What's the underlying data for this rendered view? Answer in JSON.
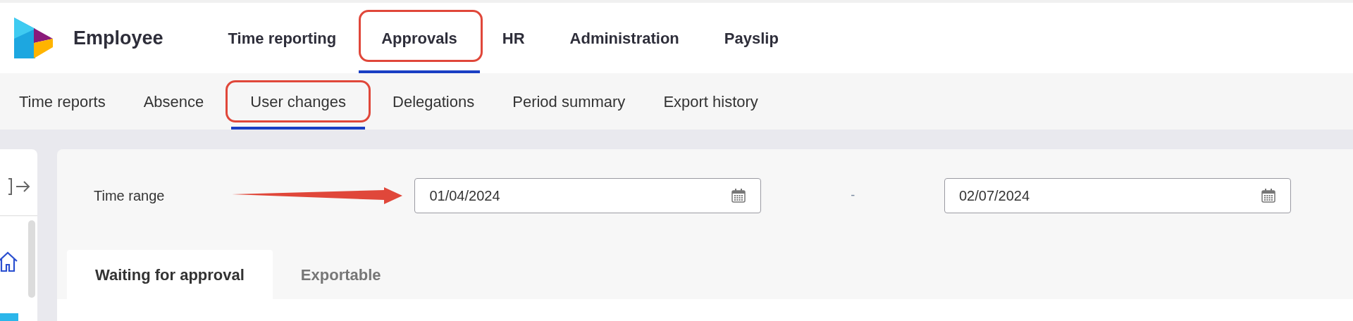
{
  "app": {
    "title": "Employee"
  },
  "nav": [
    {
      "label": "Time reporting",
      "selected": false,
      "highlighted": false
    },
    {
      "label": "Approvals",
      "selected": true,
      "highlighted": true
    },
    {
      "label": "HR",
      "selected": false,
      "highlighted": false
    },
    {
      "label": "Administration",
      "selected": false,
      "highlighted": false
    },
    {
      "label": "Payslip",
      "selected": false,
      "highlighted": false
    }
  ],
  "subnav": [
    {
      "label": "Time reports",
      "selected": false,
      "highlighted": false
    },
    {
      "label": "Absence",
      "selected": false,
      "highlighted": false
    },
    {
      "label": "User changes",
      "selected": true,
      "highlighted": true
    },
    {
      "label": "Delegations",
      "selected": false,
      "highlighted": false
    },
    {
      "label": "Period summary",
      "selected": false,
      "highlighted": false
    },
    {
      "label": "Export history",
      "selected": false,
      "highlighted": false
    }
  ],
  "filter": {
    "label": "Time range",
    "from": "01/04/2024",
    "separator": "-",
    "to": "02/07/2024"
  },
  "tabs": [
    {
      "label": "Waiting for approval",
      "selected": true
    },
    {
      "label": "Exportable",
      "selected": false
    }
  ]
}
